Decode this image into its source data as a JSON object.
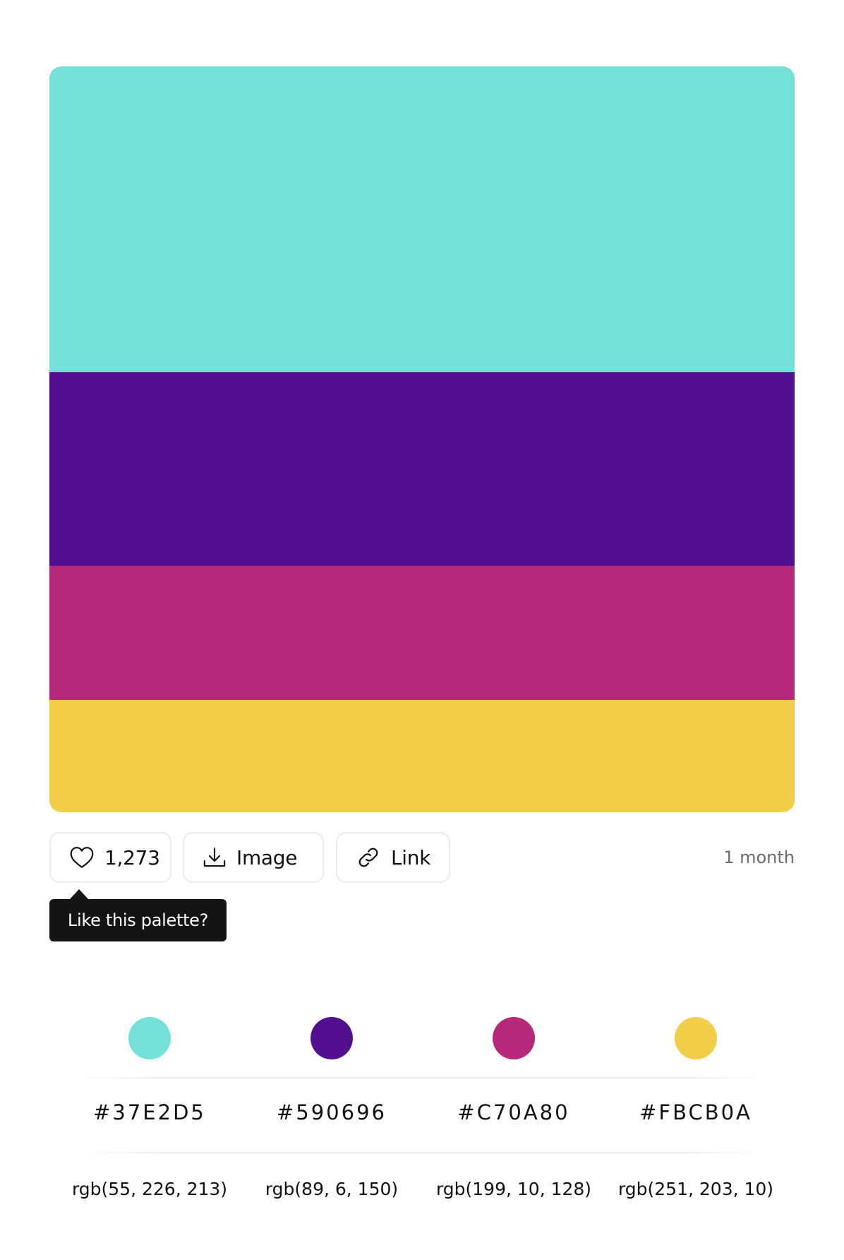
{
  "palette": {
    "colors": [
      {
        "hex": "#37E2D5",
        "rgb": "rgb(55, 226, 213)",
        "display_color": "#74E0D7"
      },
      {
        "hex": "#590696",
        "rgb": "rgb(89, 6, 150)",
        "display_color": "#520F8F"
      },
      {
        "hex": "#C70A80",
        "rgb": "rgb(199, 10, 128)",
        "display_color": "#B6287A"
      },
      {
        "hex": "#FBCB0A",
        "rgb": "rgb(251, 203, 10)",
        "display_color": "#F2CD48"
      }
    ]
  },
  "actions": {
    "likes_count": "1,273",
    "image_label": "Image",
    "link_label": "Link"
  },
  "time_ago": "1 month",
  "tooltip": {
    "text": "Like this palette?"
  },
  "icons": {
    "like": "heart-icon",
    "image": "download-icon",
    "link": "link-icon"
  }
}
